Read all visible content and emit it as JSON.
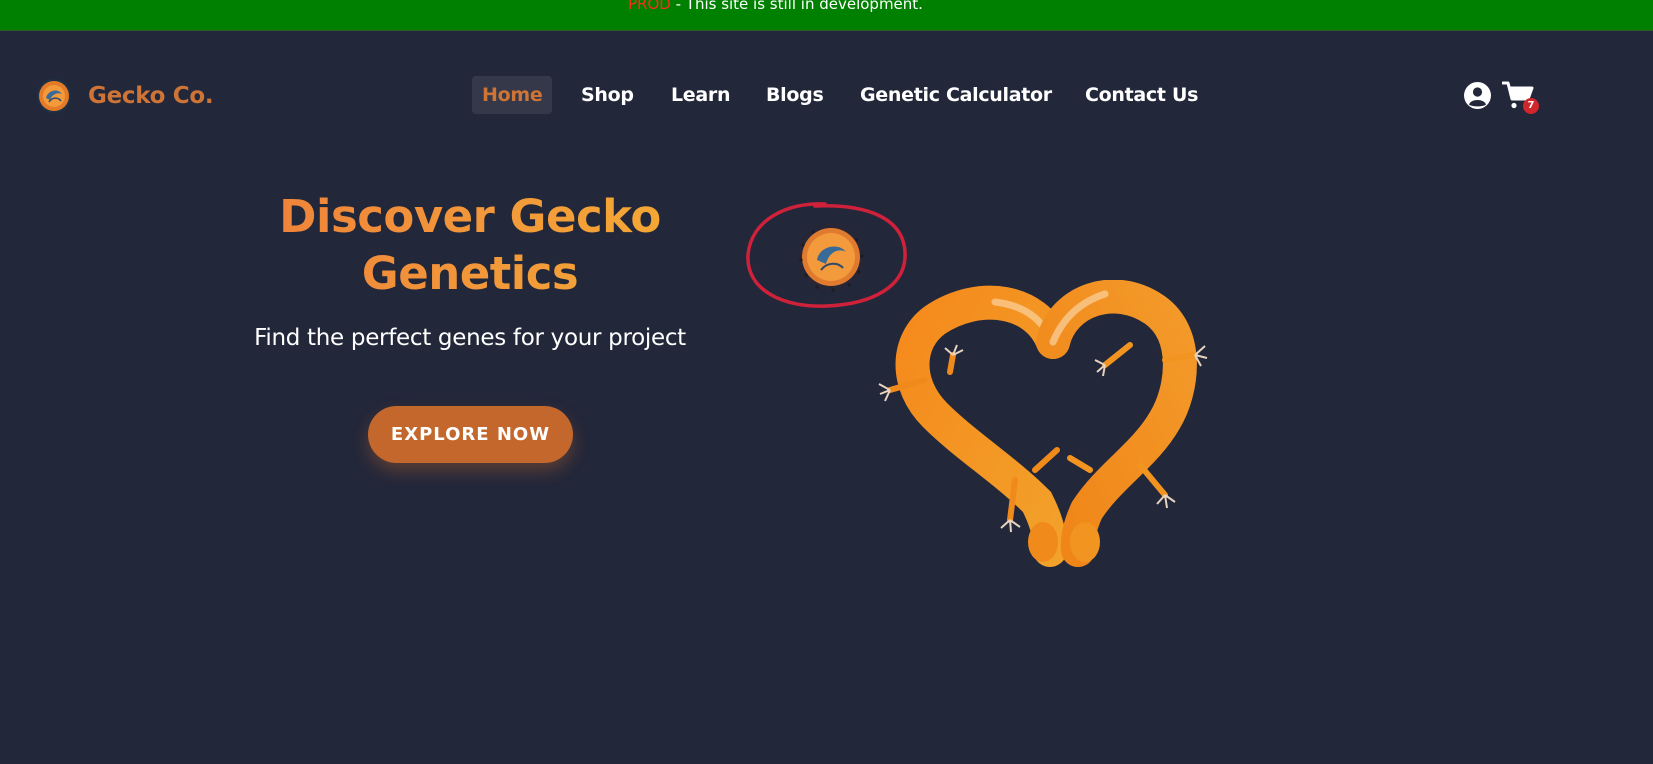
{
  "banner": {
    "env": "PROD",
    "message": " - This site is still in development."
  },
  "header": {
    "brand_name": "Gecko Co.",
    "nav": [
      "Home",
      "Shop",
      "Learn",
      "Blogs",
      "Genetic Calculator",
      "Contact Us"
    ],
    "active_nav": "Home",
    "cart_count": "7",
    "icons": [
      "account-icon",
      "cart-icon"
    ]
  },
  "hero": {
    "title_line1": "Discover Gecko",
    "title_line2": "Genetics",
    "subtitle": "Find the perfect genes for your project",
    "cta_label": "EXPLORE NOW"
  },
  "colors": {
    "background": "#23273a",
    "banner": "#008000",
    "brand": "#cd7436",
    "accent": "#c4672c",
    "annotation": "#d0213a",
    "badge": "#d0262c"
  }
}
